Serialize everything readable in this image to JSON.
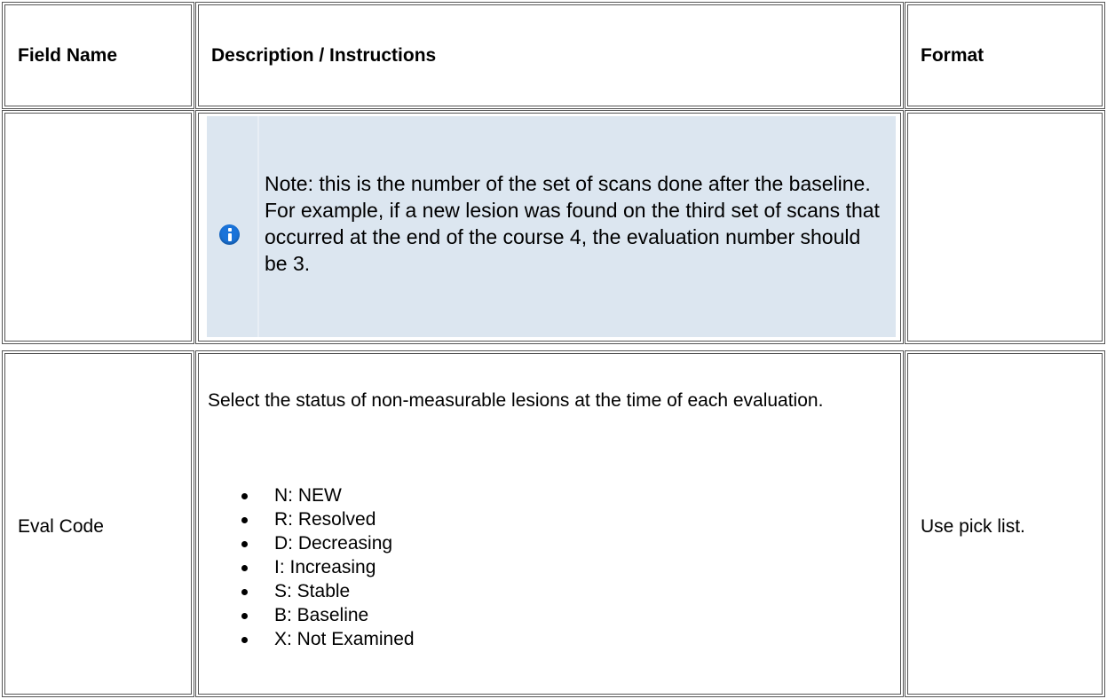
{
  "table": {
    "headers": {
      "field_name": "Field Name",
      "description": "Description / Instructions",
      "format": "Format"
    },
    "rows": [
      {
        "field_name": "",
        "note": {
          "icon": "info-icon",
          "text": "Note: this is the number of the set of scans done after the baseline. For example, if a new lesion was found on the third set of scans that occurred at the end of the course 4, the evaluation number should be 3."
        },
        "format": ""
      },
      {
        "field_name": "Eval Code",
        "description": "Select the status of non-measurable lesions at the time of each evaluation.",
        "options": [
          "N: NEW",
          "R: Resolved",
          "D: Decreasing",
          "I: Increasing",
          "S: Stable",
          "B: Baseline",
          "X: Not Examined"
        ],
        "format": "Use pick list."
      }
    ]
  },
  "colors": {
    "note_background": "#dce6f0",
    "info_icon": "#1a73d9",
    "border": "#555555"
  }
}
